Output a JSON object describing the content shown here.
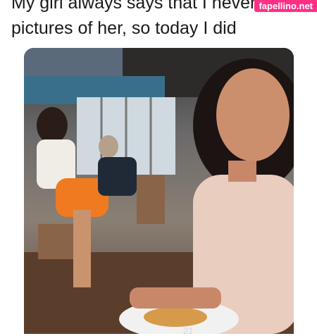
{
  "post": {
    "caption_line1": "My girl always says that I never t",
    "caption_line2": "pictures of her, so today I did"
  },
  "watermark": {
    "text": "fapellino.net"
  },
  "overlay": {
    "text": "21"
  }
}
